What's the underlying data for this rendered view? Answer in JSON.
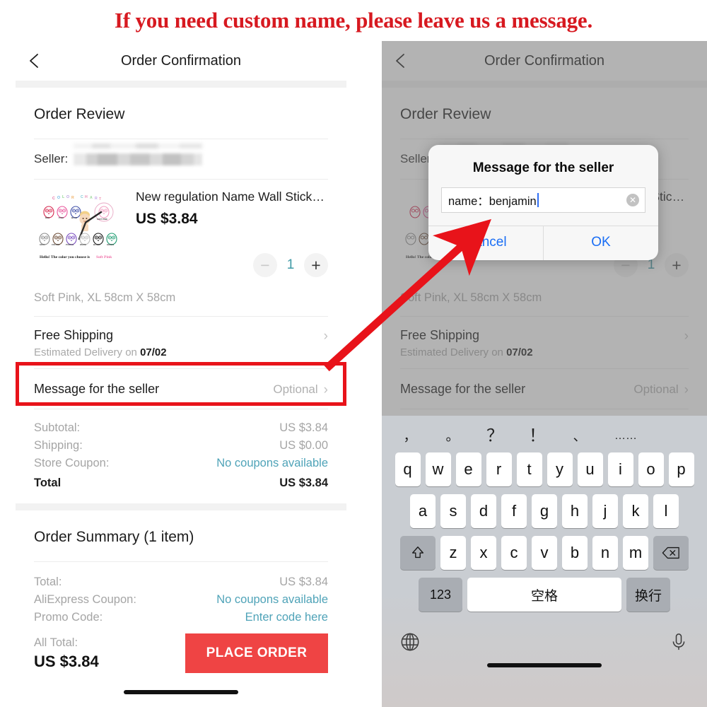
{
  "banner": {
    "text": "If you need custom name, please leave us a message."
  },
  "nav": {
    "title": "Order Confirmation",
    "back_icon": "chevron-left-icon"
  },
  "order_review": {
    "title": "Order Review",
    "seller_label": "Seller:",
    "seller_value_redacted": true,
    "product": {
      "title": "New regulation Name Wall Sticke...",
      "price": "US $3.84",
      "quantity": "1",
      "minus_label": "−",
      "plus_label": "+",
      "variant": "Soft Pink, XL 58cm X 58cm",
      "thumb_caption": "Hello! The color you choose is Soft Pink",
      "thumb_heading": "COLOR CHART",
      "thumb_colors_row1": [
        "RED",
        "PINK",
        "BLUE",
        "SOFT PINK"
      ],
      "thumb_colors_row2": [
        "GRAY",
        "COFFEE",
        "PURPLE",
        "WHITE",
        "BLACK",
        "GREEN"
      ]
    },
    "shipping": {
      "title": "Free Shipping",
      "sub_prefix": "Estimated Delivery on ",
      "sub_date": "07/02"
    },
    "message_row": {
      "label": "Message for the seller",
      "value": "Optional"
    },
    "totals": [
      {
        "label": "Subtotal:",
        "value": "US $3.84",
        "link": false
      },
      {
        "label": "Shipping:",
        "value": "US $0.00",
        "link": false
      },
      {
        "label": "Store Coupon:",
        "value": "No coupons available",
        "link": true
      }
    ],
    "total_line": {
      "label": "Total",
      "value": "US $3.84"
    }
  },
  "order_summary": {
    "title": "Order Summary (1 item)",
    "lines": [
      {
        "label": "Total:",
        "value": "US $3.84",
        "link": false
      },
      {
        "label": "AliExpress Coupon:",
        "value": "No coupons available",
        "link": true
      },
      {
        "label": "Promo Code:",
        "value": "Enter code here",
        "link": true
      }
    ],
    "all_total_label": "All Total:",
    "all_total_value": "US $3.84",
    "place_order_label": "PLACE ORDER"
  },
  "dialog": {
    "title": "Message for the seller",
    "input_value": "name：benjamin",
    "clear_icon": "circle-x-icon",
    "cancel_label": "Cancel",
    "ok_label": "OK"
  },
  "keyboard": {
    "punctuation": [
      "，",
      "。",
      "？",
      "！",
      "、",
      "……"
    ],
    "row1": [
      "q",
      "w",
      "e",
      "r",
      "t",
      "y",
      "u",
      "i",
      "o",
      "p"
    ],
    "row2": [
      "a",
      "s",
      "d",
      "f",
      "g",
      "h",
      "j",
      "k",
      "l"
    ],
    "row3": [
      "z",
      "x",
      "c",
      "v",
      "b",
      "n",
      "m"
    ],
    "shift_icon": "shift-arrow-icon",
    "backspace_icon": "backspace-icon",
    "num_label": "123",
    "space_label": "空格",
    "return_label": "换行",
    "globe_icon": "globe-icon",
    "mic_icon": "microphone-icon"
  },
  "annotation": {
    "highlight_color": "#e8131a",
    "arrow_color": "#e8131a",
    "banner_color": "#d71920",
    "accent_red": "#ef4444",
    "link_teal": "#4fa3b8",
    "ios_blue": "#1a6ef5"
  }
}
